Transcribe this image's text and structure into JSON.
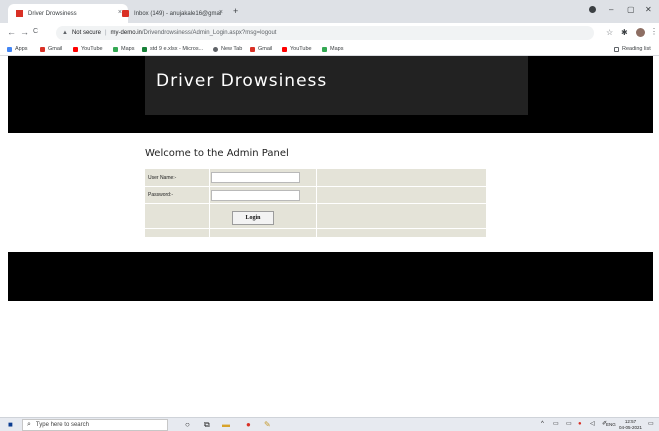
{
  "browser": {
    "tabs": [
      {
        "title": "Driver Drowsiness",
        "active": true
      },
      {
        "title": "Inbox (149) - anujakale16@gmai",
        "active": false
      }
    ],
    "new_tab_symbol": "+",
    "close_symbol": "×",
    "window_controls": {
      "minimize": "–",
      "maximize": "▢",
      "close": "✕"
    },
    "nav": {
      "back": "←",
      "forward": "→",
      "reload": "C"
    },
    "address": {
      "security": "Not secure",
      "host": "my-demo.in",
      "path": "/Drivendrowsiness/Admin_Login.aspx?msg=logout"
    },
    "bookmarks": [
      {
        "label": "Apps",
        "color": "#4285f4"
      },
      {
        "label": "Gmail",
        "color": "#d93025"
      },
      {
        "label": "YouTube",
        "color": "#ff0000"
      },
      {
        "label": "Maps",
        "color": "#34a853"
      },
      {
        "label": "std 9 e.xlsx - Micros...",
        "color": "#188038"
      },
      {
        "label": "New Tab",
        "color": "#5f6368"
      },
      {
        "label": "Gmail",
        "color": "#d93025"
      },
      {
        "label": "YouTube",
        "color": "#ff0000"
      },
      {
        "label": "Maps",
        "color": "#34a853"
      }
    ],
    "reading_list": "Reading list"
  },
  "page": {
    "site_title": "Driver Drowsiness",
    "welcome": "Welcome to the Admin Panel",
    "form": {
      "username_label": "User Name:-",
      "password_label": "Password:-",
      "username_value": "",
      "password_value": "",
      "login_label": "Login"
    }
  },
  "taskbar": {
    "search_placeholder": "Type here to search",
    "language": "ENG",
    "time": "12:57",
    "date": "04-05-2021"
  },
  "colors": {
    "header_band": "#000000",
    "header_box": "#222222",
    "form_bg": "#e4e3d8"
  }
}
